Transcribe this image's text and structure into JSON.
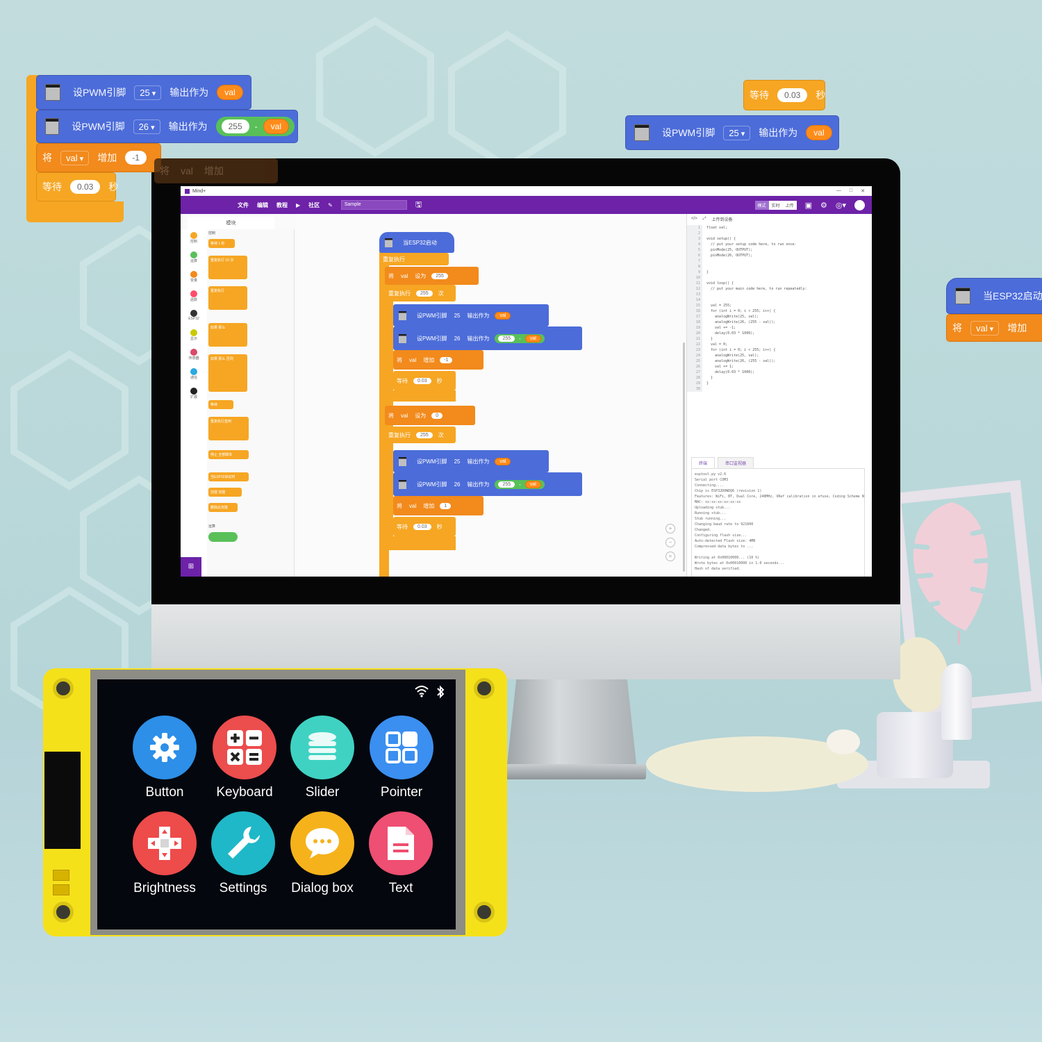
{
  "floating_blocks": {
    "left_group": {
      "pwm1": {
        "label": "设PWM引脚",
        "pin": "25",
        "output_label": "输出作为",
        "value_var": "val"
      },
      "pwm2": {
        "label": "设PWM引脚",
        "pin": "26",
        "output_label": "输出作为",
        "value_num": "255",
        "operator": "-",
        "value_var": "val"
      },
      "change": {
        "prefix": "将",
        "var": "val",
        "action": "增加",
        "amount": "-1"
      },
      "wait": {
        "prefix": "等待",
        "seconds": "0.03",
        "suffix": "秒"
      },
      "shadow_change": {
        "prefix": "将",
        "var": "val",
        "action": "增加"
      }
    },
    "right_group": {
      "wait": {
        "prefix": "等待",
        "seconds": "0.03",
        "suffix": "秒"
      },
      "pwm": {
        "label": "设PWM引脚",
        "pin": "25",
        "output_label": "输出作为",
        "value_var": "val"
      }
    },
    "edge_group": {
      "hat": {
        "label": "当ESP32启动"
      },
      "change": {
        "prefix": "将",
        "var": "val",
        "action": "增加"
      }
    }
  },
  "app_window": {
    "title": "Mind+",
    "window_controls": [
      "—",
      "□",
      "✕"
    ],
    "menu_items": [
      "文件",
      "编辑",
      "教程",
      "▶",
      "社区"
    ],
    "project_name": "Sample",
    "mode_switch": {
      "left": "模式",
      "middle": "实时",
      "right": "上传"
    },
    "category_tab": "模块",
    "categories": [
      {
        "label": "控制",
        "color": "#f6a623"
      },
      {
        "label": "运算",
        "color": "#59c059"
      },
      {
        "label": "变量",
        "color": "#f28a1c"
      },
      {
        "label": "函数",
        "color": "#ff4d6a"
      },
      {
        "label": "ESP32",
        "color": "#333333"
      },
      {
        "label": "显示",
        "color": "#c9c900"
      },
      {
        "label": "传感器",
        "color": "#d94a6a"
      },
      {
        "label": "通信",
        "color": "#2aa9e0"
      },
      {
        "label": "扩展",
        "color": "#222222"
      }
    ],
    "palette_section_control": "控制",
    "palette_blocks": [
      "等待 1 秒",
      "重复执行 10 次",
      "重复执行",
      "如果 那么",
      "如果 那么 否则",
      "等待",
      "重复执行直到",
      "停止 全部脚本",
      "当ESP32启动时",
      "创建 克隆",
      "删除此克隆"
    ],
    "palette_section_operators": "运算",
    "code_tools": [
      "</>",
      "⤢",
      "上传到设备"
    ],
    "output_tabs": [
      "终端",
      "串口监视器"
    ]
  },
  "workspace": {
    "hat": "当ESP32启动",
    "forever": "重复执行",
    "set1": {
      "prefix": "将",
      "var": "val",
      "action": "设为",
      "value": "255"
    },
    "repeat1": {
      "prefix": "重复执行",
      "times": "255",
      "suffix": "次"
    },
    "pwm_a1": {
      "label": "设PWM引脚",
      "pin": "25",
      "output_label": "输出作为",
      "var": "val"
    },
    "pwm_b1": {
      "label": "设PWM引脚",
      "pin": "26",
      "output_label": "输出作为",
      "num": "255",
      "op": "-",
      "var": "val"
    },
    "change1": {
      "prefix": "将",
      "var": "val",
      "action": "增加",
      "value": "-1"
    },
    "wait1": {
      "prefix": "等待",
      "value": "0.03",
      "suffix": "秒"
    },
    "set2": {
      "prefix": "将",
      "var": "val",
      "action": "设为",
      "value": "0"
    },
    "repeat2": {
      "prefix": "重复执行",
      "times": "255",
      "suffix": "次"
    },
    "pwm_a2": {
      "label": "设PWM引脚",
      "pin": "25",
      "output_label": "输出作为",
      "var": "val"
    },
    "pwm_b2": {
      "label": "设PWM引脚",
      "pin": "26",
      "output_label": "输出作为",
      "num": "255",
      "op": "-",
      "var": "val"
    },
    "change2": {
      "prefix": "将",
      "var": "val",
      "action": "增加",
      "value": "1"
    },
    "wait2": {
      "prefix": "等待",
      "value": "0.03",
      "suffix": "秒"
    },
    "zoom_controls": [
      "+",
      "−",
      "="
    ]
  },
  "code": [
    {
      "n": "1",
      "t": "float val;"
    },
    {
      "n": "2",
      "t": ""
    },
    {
      "n": "3",
      "t": "void setup() {"
    },
    {
      "n": "4",
      "t": "  // put your setup code here, to run once:"
    },
    {
      "n": "5",
      "t": "  pinMode(25, OUTPUT);"
    },
    {
      "n": "6",
      "t": "  pinMode(26, OUTPUT);"
    },
    {
      "n": "7",
      "t": ""
    },
    {
      "n": "8",
      "t": ""
    },
    {
      "n": "9",
      "t": "}"
    },
    {
      "n": "10",
      "t": ""
    },
    {
      "n": "11",
      "t": "void loop() {"
    },
    {
      "n": "12",
      "t": "  // put your main code here, to run repeatedly:"
    },
    {
      "n": "13",
      "t": ""
    },
    {
      "n": "14",
      "t": ""
    },
    {
      "n": "15",
      "t": "  val = 255;"
    },
    {
      "n": "16",
      "t": "  for (int i = 0; i < 255; i++) {"
    },
    {
      "n": "17",
      "t": "    analogWrite(25, val);"
    },
    {
      "n": "18",
      "t": "    analogWrite(26, (255 - val));"
    },
    {
      "n": "19",
      "t": "    val += -1;"
    },
    {
      "n": "20",
      "t": "    delay(0.03 * 1000);"
    },
    {
      "n": "21",
      "t": "  }"
    },
    {
      "n": "22",
      "t": "  val = 0;"
    },
    {
      "n": "23",
      "t": "  for (int i = 0; i < 255; i++) {"
    },
    {
      "n": "24",
      "t": "    analogWrite(25, val);"
    },
    {
      "n": "25",
      "t": "    analogWrite(26, (255 - val));"
    },
    {
      "n": "26",
      "t": "    val += 1;"
    },
    {
      "n": "27",
      "t": "    delay(0.03 * 1000);"
    },
    {
      "n": "28",
      "t": "  }"
    },
    {
      "n": "29",
      "t": "}"
    },
    {
      "n": "30",
      "t": ""
    }
  ],
  "output_log": "esptool.py v2.6\nSerial port COM3\nConnecting....\nChip is ESP32D0WDQ6 (revision 1)\nFeatures: WiFi, BT, Dual Core, 240MHz, VRef calibration in efuse, Coding Scheme None\nMAC: xx:xx:xx:xx:xx:xx\nUploading stub...\nRunning stub...\nStub running...\nChanging baud rate to 921600\nChanged.\nConfiguring flash size...\nAuto-detected Flash size: 4MB\nCompressed data bytes to ...\n\nWriting at 0x00010000... (10 %)\nWrote bytes at 0x00010000 in 1.0 seconds...\nHash of data verified.",
  "device": {
    "status_icons": [
      "wifi-icon",
      "bluetooth-icon"
    ],
    "apps": [
      {
        "name": "Button",
        "icon": "gear-icon",
        "color": "#2d8fe8"
      },
      {
        "name": "Keyboard",
        "icon": "calculator-icon",
        "color": "#ec4d4d"
      },
      {
        "name": "Slider",
        "icon": "database-icon",
        "color": "#3fd2c2"
      },
      {
        "name": "Pointer",
        "icon": "grid-icon",
        "color": "#3b8ff0"
      },
      {
        "name": "Brightness",
        "icon": "dpad-icon",
        "color": "#ee4b4b"
      },
      {
        "name": "Settings",
        "icon": "wrench-icon",
        "color": "#1fb8c8"
      },
      {
        "name": "Dialog box",
        "icon": "chat-bubble-icon",
        "color": "#f6b21b"
      },
      {
        "name": "Text",
        "icon": "document-icon",
        "color": "#ee4f72"
      }
    ]
  }
}
